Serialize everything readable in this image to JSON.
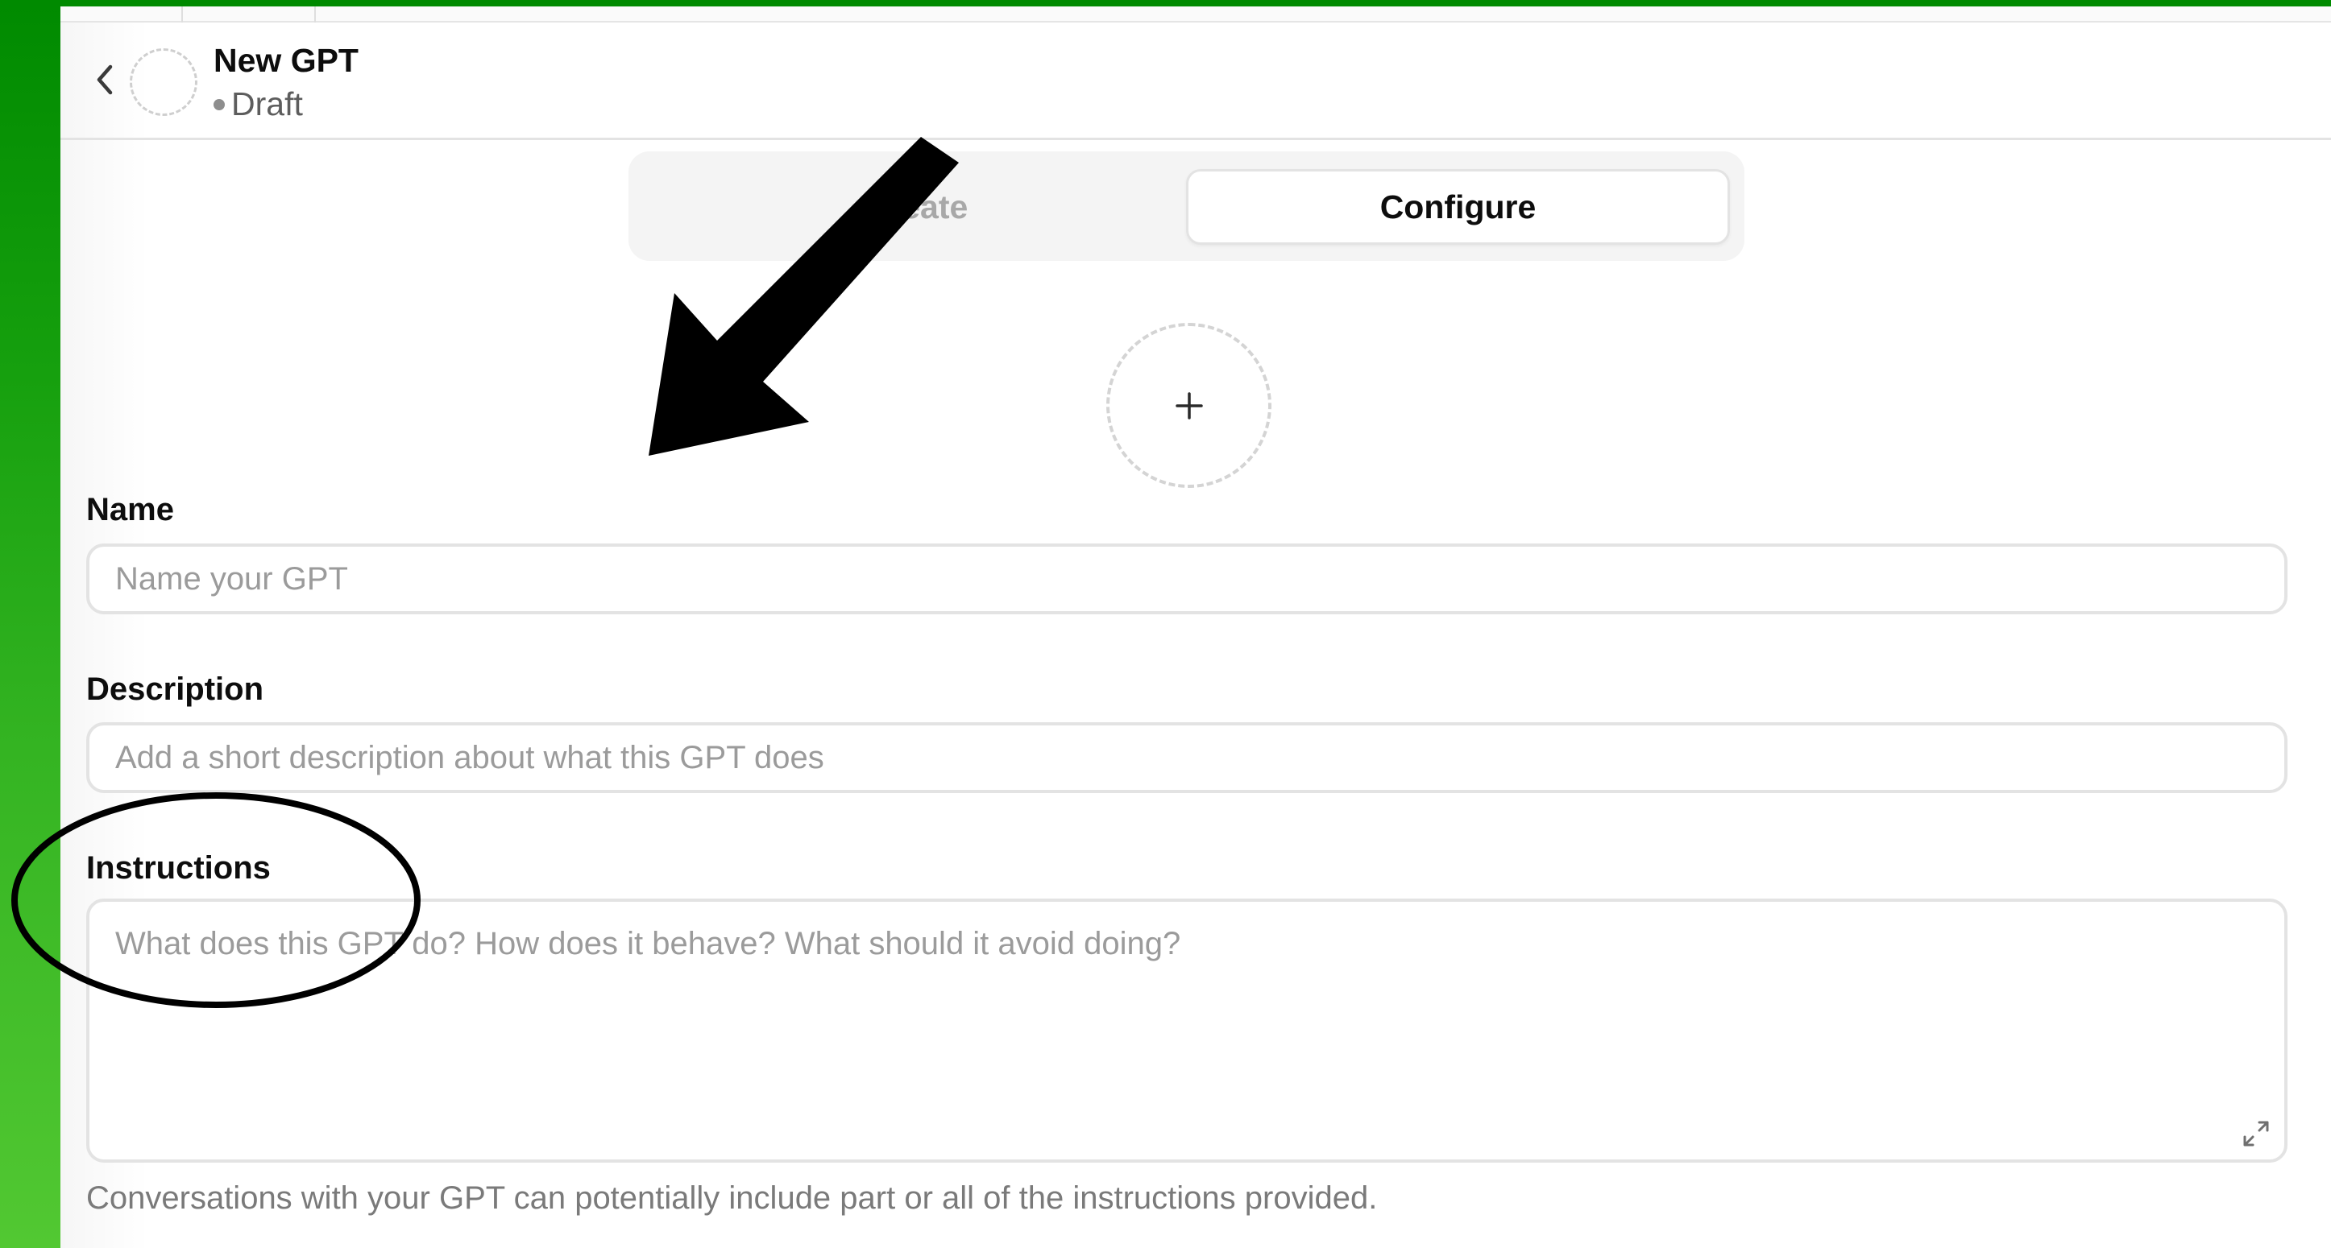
{
  "header": {
    "title": "New GPT",
    "status": "Draft"
  },
  "tabs": [
    {
      "label": "Create",
      "active": false
    },
    {
      "label": "Configure",
      "active": true
    }
  ],
  "form": {
    "name": {
      "label": "Name",
      "placeholder": "Name your GPT",
      "value": ""
    },
    "description": {
      "label": "Description",
      "placeholder": "Add a short description about what this GPT does",
      "value": ""
    },
    "instructions": {
      "label": "Instructions",
      "placeholder": "What does this GPT do? How does it behave? What should it avoid doing?",
      "value": ""
    },
    "hint": "Conversations with your GPT can potentially include part or all of the instructions provided."
  },
  "icons": {
    "back": "chevron-left-icon",
    "avatar_upload": "plus-icon",
    "expand": "expand-icon"
  },
  "colors": {
    "background_top": "#008a00",
    "background_bottom": "#52c832",
    "annotation": "#000000"
  }
}
